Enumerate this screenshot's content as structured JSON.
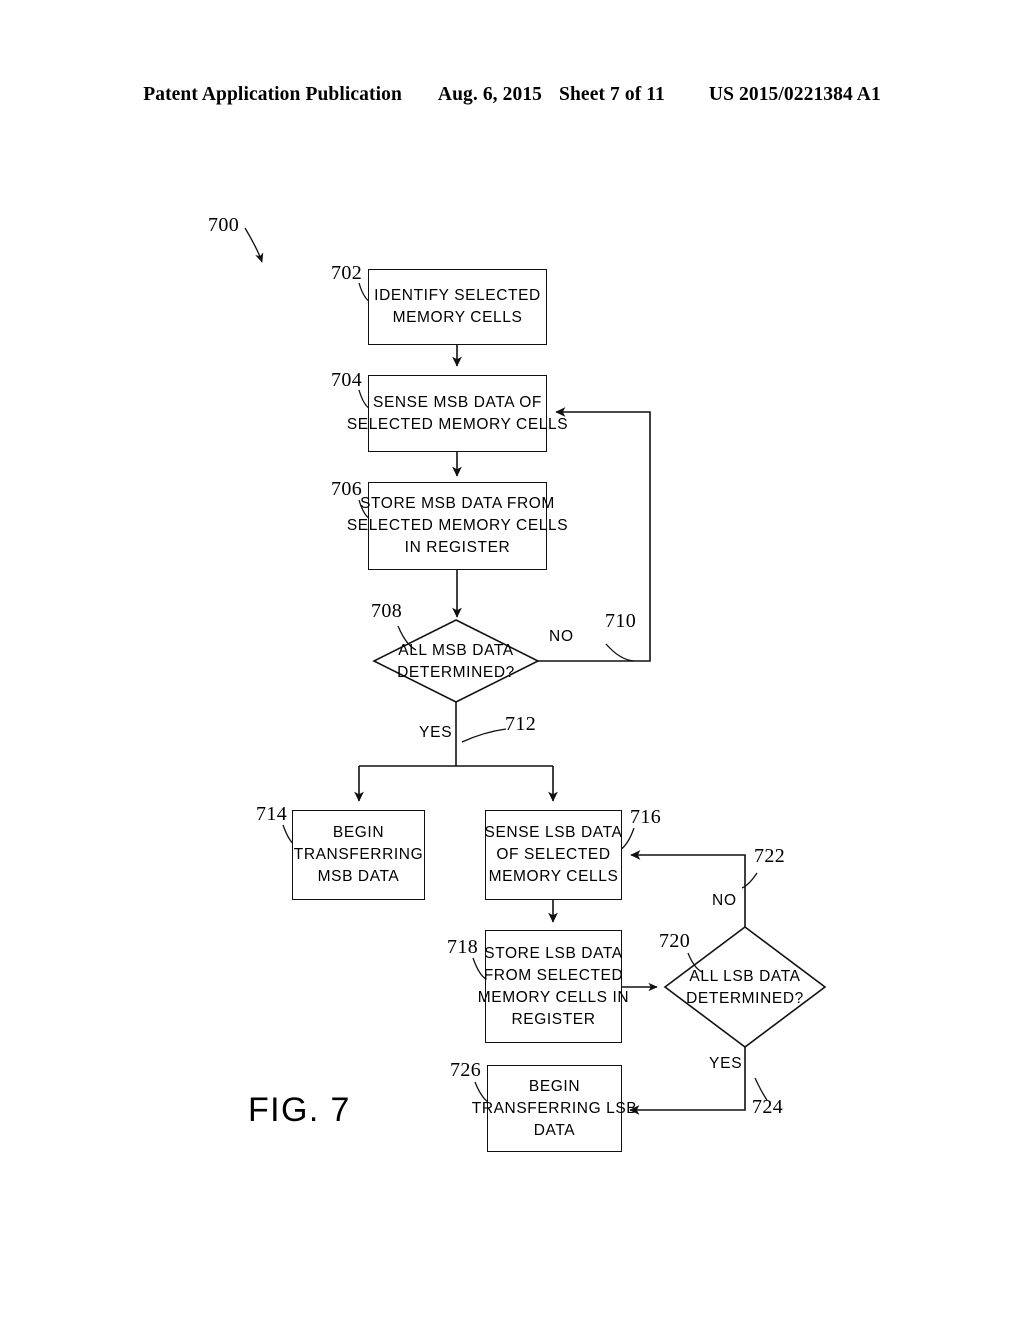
{
  "header": {
    "publication": "Patent Application Publication",
    "date": "Aug. 6, 2015",
    "sheet": "Sheet 7 of 11",
    "patent_number": "US 2015/0221384 A1"
  },
  "figure": {
    "caption": "FIG. 7",
    "figure_ref": "700",
    "nodes": [
      {
        "ref": "702",
        "type": "process",
        "lines": [
          "IDENTIFY SELECTED",
          "MEMORY CELLS"
        ]
      },
      {
        "ref": "704",
        "type": "process",
        "lines": [
          "SENSE MSB DATA OF",
          "SELECTED MEMORY CELLS"
        ]
      },
      {
        "ref": "706",
        "type": "process",
        "lines": [
          "STORE MSB DATA FROM",
          "SELECTED MEMORY CELLS",
          "IN REGISTER"
        ]
      },
      {
        "ref": "708",
        "type": "decision",
        "lines": [
          "ALL MSB DATA",
          "DETERMINED?"
        ]
      },
      {
        "ref": "714",
        "type": "process",
        "lines": [
          "BEGIN",
          "TRANSFERRING",
          "MSB DATA"
        ]
      },
      {
        "ref": "716",
        "type": "process",
        "lines": [
          "SENSE LSB DATA",
          "OF SELECTED",
          "MEMORY CELLS"
        ]
      },
      {
        "ref": "718",
        "type": "process",
        "lines": [
          "STORE LSB DATA",
          "FROM SELECTED",
          "MEMORY CELLS IN",
          "REGISTER"
        ]
      },
      {
        "ref": "720",
        "type": "decision",
        "lines": [
          "ALL LSB DATA",
          "DETERMINED?"
        ]
      },
      {
        "ref": "726",
        "type": "process",
        "lines": [
          "BEGIN",
          "TRANSFERRING LSB",
          "DATA"
        ]
      }
    ],
    "branches": [
      {
        "ref": "710",
        "label": "NO",
        "from": "708",
        "to": "704"
      },
      {
        "ref": "712",
        "label": "YES",
        "from": "708",
        "to": "714 and 716"
      },
      {
        "ref": "722",
        "label": "NO",
        "from": "720",
        "to": "716"
      },
      {
        "ref": "724",
        "label": "YES",
        "from": "720",
        "to": "726"
      }
    ]
  },
  "style": {
    "line_color": "#111111",
    "background": "#ffffff"
  }
}
